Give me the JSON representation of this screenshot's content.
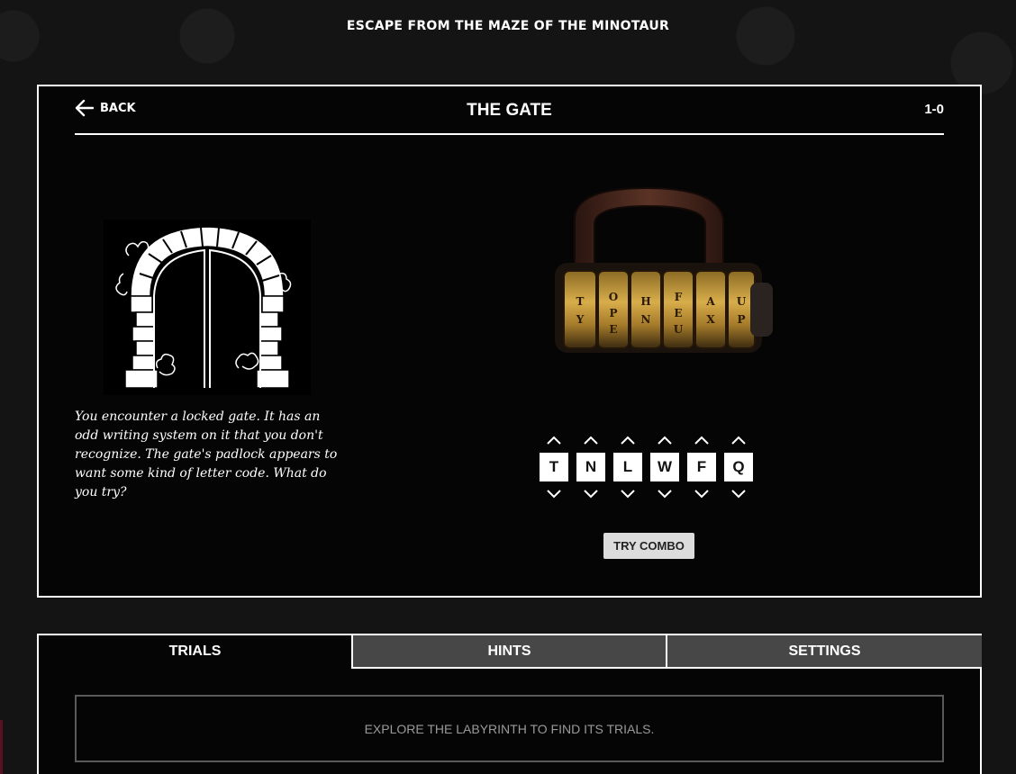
{
  "site": {
    "title": "ESCAPE FROM THE MAZE OF THE MINOTAUR"
  },
  "puzzle": {
    "back_label": "BACK",
    "title": "THE GATE",
    "level": "1-0",
    "description": "You encounter a locked gate. It has an odd writing system on it that you don't recognize. The gate's padlock appears to want some kind of letter code. What do you try?",
    "combination": [
      "T",
      "N",
      "L",
      "W",
      "F",
      "Q"
    ],
    "try_label": "TRY COMBO"
  },
  "tabs": [
    {
      "label": "TRIALS",
      "active": true
    },
    {
      "label": "HINTS",
      "active": false
    },
    {
      "label": "SETTINGS",
      "active": false
    }
  ],
  "trials": {
    "message": "EXPLORE THE LABYRINTH TO FIND ITS TRIALS."
  },
  "icons": {
    "back": "arrow-left-icon",
    "up": "chevron-up-icon",
    "down": "chevron-down-icon"
  },
  "colors": {
    "background": "#141414",
    "panel": "#050505",
    "inactive_tab": "#474747",
    "button": "#dcdcdc",
    "muted_text": "#9a9a9a"
  }
}
